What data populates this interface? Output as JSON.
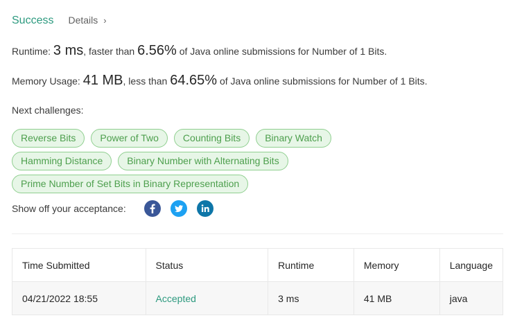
{
  "header": {
    "status": "Success",
    "details_label": "Details",
    "details_chevron": "›"
  },
  "runtime": {
    "label": "Runtime:",
    "value": "3 ms",
    "comparison": ", faster than",
    "percent": "6.56%",
    "suffix": "of Java online submissions for Number of 1 Bits."
  },
  "memory": {
    "label": "Memory Usage:",
    "value": "41 MB",
    "comparison": ", less than",
    "percent": "64.65%",
    "suffix": "of Java online submissions for Number of 1 Bits."
  },
  "next_challenges": {
    "label": "Next challenges:",
    "rows": [
      [
        "Reverse Bits",
        "Power of Two",
        "Counting Bits",
        "Binary Watch"
      ],
      [
        "Hamming Distance",
        "Binary Number with Alternating Bits"
      ],
      [
        "Prime Number of Set Bits in Binary Representation"
      ]
    ]
  },
  "share": {
    "label": "Show off your acceptance:",
    "icons": [
      "facebook-icon",
      "twitter-icon",
      "linkedin-icon"
    ],
    "colors": {
      "facebook": "#3a5798",
      "twitter": "#1da1f2",
      "linkedin": "#0e76a8"
    }
  },
  "submissions": {
    "headers": [
      "Time Submitted",
      "Status",
      "Runtime",
      "Memory",
      "Language"
    ],
    "rows": [
      {
        "time": "04/21/2022 18:55",
        "status": "Accepted",
        "runtime": "3 ms",
        "memory": "41 MB",
        "language": "java"
      }
    ]
  },
  "colors": {
    "success": "#2d9a7f",
    "chip_bg": "#e7f6e7",
    "chip_border": "#8fcf8f",
    "chip_text": "#4d9f4d"
  }
}
